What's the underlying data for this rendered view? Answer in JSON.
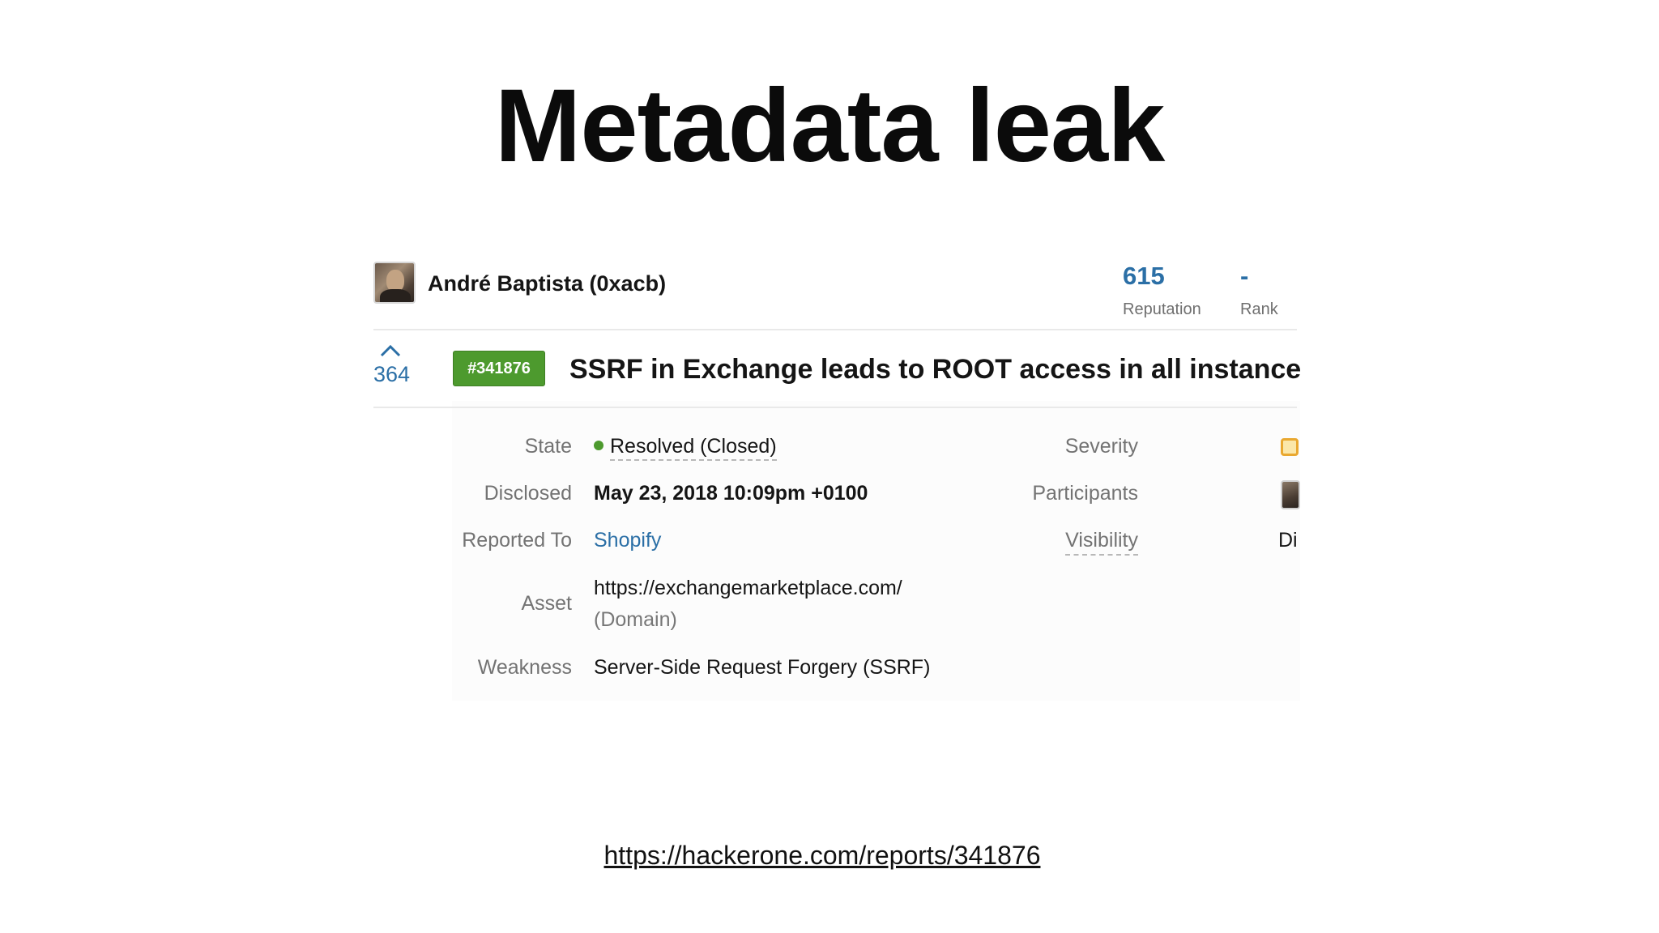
{
  "slide": {
    "title": "Metadata leak",
    "source_url": "https://hackerone.com/reports/341876"
  },
  "profile": {
    "name": "André Baptista (0xacb)",
    "reputation_value": "615",
    "reputation_label": "Reputation",
    "rank_value": "-",
    "rank_label": "Rank"
  },
  "report": {
    "votes": "364",
    "id_badge": "#341876",
    "title": "SSRF in Exchange leads to ROOT access in all instances"
  },
  "details": {
    "state_label": "State",
    "state_value": "Resolved (Closed)",
    "disclosed_label": "Disclosed",
    "disclosed_value": "May 23, 2018 10:09pm +0100",
    "reported_to_label": "Reported To",
    "reported_to_value": "Shopify",
    "asset_label": "Asset",
    "asset_value": "https://exchangemarketplace.com/",
    "asset_type": "(Domain)",
    "weakness_label": "Weakness",
    "weakness_value": "Server-Side Request Forgery (SSRF)"
  },
  "side_details": {
    "severity_label": "Severity",
    "participants_label": "Participants",
    "visibility_label": "Visibility",
    "visibility_value": "Di"
  },
  "colors": {
    "accent_blue": "#2b6fa6",
    "resolved_green": "#4d9a2e",
    "severity_orange": "#e9a830"
  },
  "icons": {
    "vote": "chevron-up-icon",
    "state": "status-dot-icon",
    "severity": "severity-icon"
  }
}
